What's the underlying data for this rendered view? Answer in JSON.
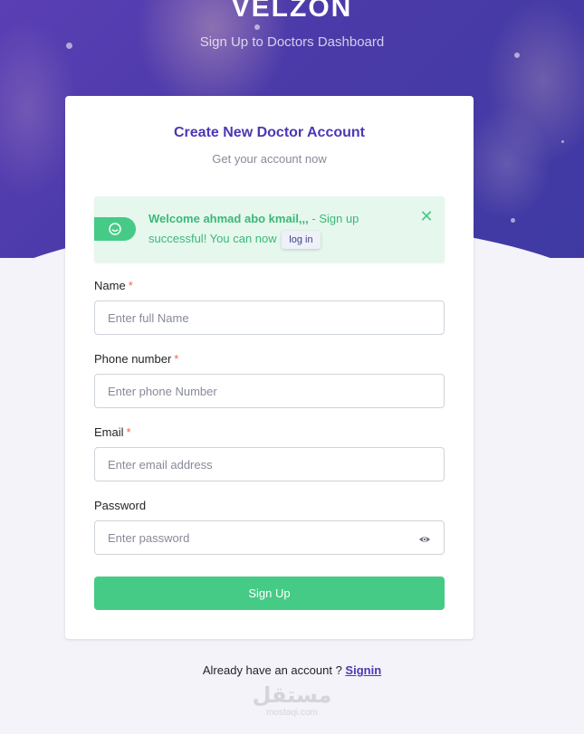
{
  "brand": {
    "logo": "VELZON",
    "tagline": "Sign Up to Doctors Dashboard"
  },
  "card": {
    "title": "Create New Doctor Account",
    "subtitle": "Get your account now"
  },
  "alert": {
    "bold_text": "Welcome ahmad abo kmail,,,",
    "text": " - Sign up successful! You can now",
    "link_label": "log in",
    "icon": "smile-icon",
    "close_icon": "close-icon"
  },
  "form": {
    "name": {
      "label": "Name",
      "required": "*",
      "placeholder": "Enter full Name",
      "value": ""
    },
    "phone": {
      "label": "Phone number",
      "required": "*",
      "placeholder": "Enter phone Number",
      "value": ""
    },
    "email": {
      "label": "Email",
      "required": "*",
      "placeholder": "Enter email address",
      "value": ""
    },
    "password": {
      "label": "Password",
      "placeholder": "Enter password",
      "value": "",
      "toggle_icon": "eye-icon"
    },
    "submit_label": "Sign Up"
  },
  "footer": {
    "text": "Already have an account ? ",
    "link_label": "Signin"
  },
  "watermark": {
    "arabic": "مستقل",
    "latin": "mostaqi.com"
  },
  "colors": {
    "hero": "#4a3aa8",
    "primary": "#4b38b3",
    "success": "#45cb85",
    "danger": "#f06548",
    "page_bg": "#f3f3f9"
  }
}
